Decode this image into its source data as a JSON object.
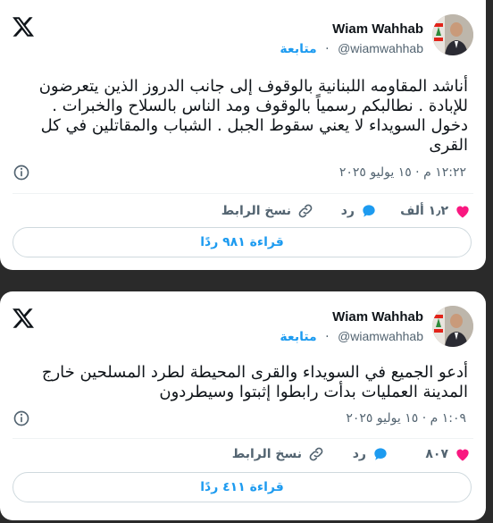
{
  "tweets": [
    {
      "author_name": "Wiam Wahhab",
      "handle": "@wiamwahhab",
      "follow_label": "متابعة",
      "text": "أناشد المقاومه اللبنانية بالوقوف إلى جانب الدروز الذين يتعرضون للإبادة . نطالبكم رسمياً بالوقوف ومد الناس بالسلاح والخبرات . دخول السويداء لا يعني سقوط الجبل . الشباب والمقاتلين في كل القرى",
      "timestamp": "١٢:٢٢ م · ١٥ يوليو ٢٠٢٥",
      "likes": "١٫٢ ألف",
      "reply_label": "رد",
      "copy_link_label": "نسخ الرابط",
      "read_replies_label": "قراءة ٩٨١ ردًا"
    },
    {
      "author_name": "Wiam Wahhab",
      "handle": "@wiamwahhab",
      "follow_label": "متابعة",
      "text": "أدعو الجميع في السويداء والقرى المحيطة لطرد المسلحين خارج المدينة العمليات بدأت رابطوا إثبتوا وسيطردون",
      "timestamp": "١:٠٩ م · ١٥ يوليو ٢٠٢٥",
      "likes": "٨٠٧",
      "reply_label": "رد",
      "copy_link_label": "نسخ الرابط",
      "read_replies_label": "قراءة ٤١١ ردًا"
    }
  ],
  "colors": {
    "accent": "#1d9bf0",
    "like": "#f91880",
    "text": "#0f1419",
    "muted": "#536471"
  },
  "icons": [
    "x-logo-icon",
    "info-icon",
    "heart-icon",
    "reply-bubble-icon",
    "link-icon"
  ]
}
